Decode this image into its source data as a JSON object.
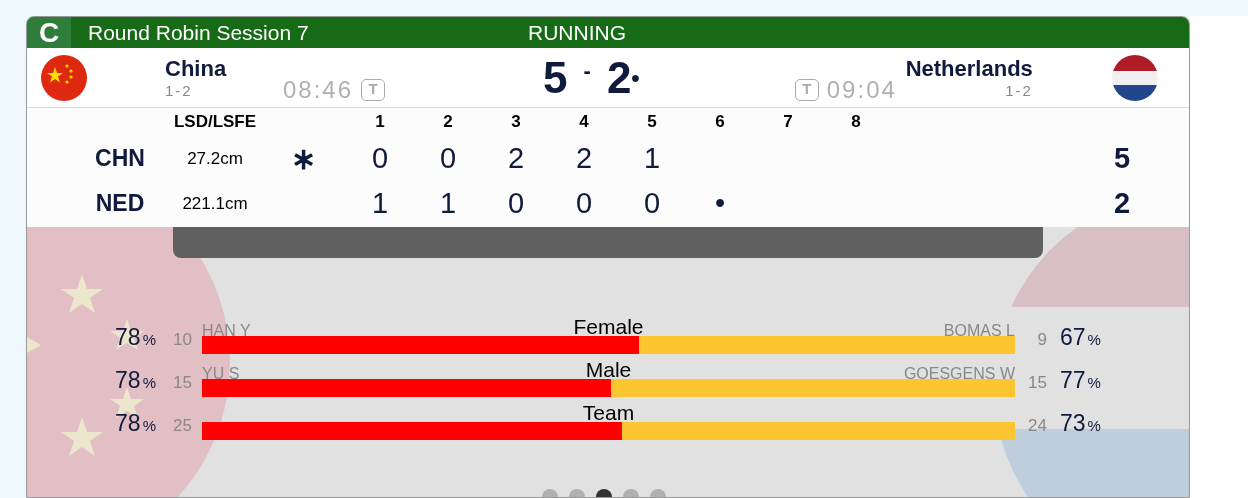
{
  "header": {
    "badge": "C",
    "title": "Round Robin Session 7",
    "status": "RUNNING"
  },
  "teams": [
    {
      "name": "China",
      "record": "1-2",
      "clock": "08:46",
      "timeout": "T",
      "score": "5",
      "kind": "china"
    },
    {
      "name": "Netherlands",
      "record": "1-2",
      "clock": "09:04",
      "timeout": "T",
      "score": "2",
      "score_mark": "•",
      "kind": "netherlands"
    }
  ],
  "score_separator": "-",
  "linescore": {
    "lsd_heading": "LSD/LSFE",
    "ends": [
      "1",
      "2",
      "3",
      "4",
      "5",
      "6",
      "7",
      "8"
    ],
    "rows": [
      {
        "code": "CHN",
        "lsd": "27.2cm",
        "mark": "∗",
        "ends": [
          "0",
          "0",
          "2",
          "2",
          "1"
        ],
        "total": "5"
      },
      {
        "code": "NED",
        "lsd": "221.1cm",
        "ends": [
          "1",
          "1",
          "0",
          "0",
          "0",
          "•"
        ],
        "total": "2"
      }
    ]
  },
  "stats": [
    {
      "label": "Female",
      "level": 0.537,
      "left": {
        "player": "HAN Y",
        "count": "10",
        "pct": "78",
        "unit": "%"
      },
      "right": {
        "player": "BOMAS L",
        "count": "9",
        "pct": "67",
        "unit": "%"
      }
    },
    {
      "label": "Male",
      "level": 0.503,
      "left": {
        "player": "YU S",
        "count": "15",
        "pct": "78",
        "unit": "%"
      },
      "right": {
        "player": "GOESGENS W",
        "count": "15",
        "pct": "77",
        "unit": "%"
      }
    },
    {
      "label": "Team",
      "level": 0.517,
      "left": {
        "count": "25",
        "pct": "78",
        "unit": "%"
      },
      "right": {
        "count": "24",
        "pct": "73",
        "unit": "%"
      }
    }
  ],
  "pager": [
    {
      "selected": false
    },
    {
      "selected": false
    },
    {
      "selected": true
    },
    {
      "selected": false
    },
    {
      "selected": false
    }
  ]
}
